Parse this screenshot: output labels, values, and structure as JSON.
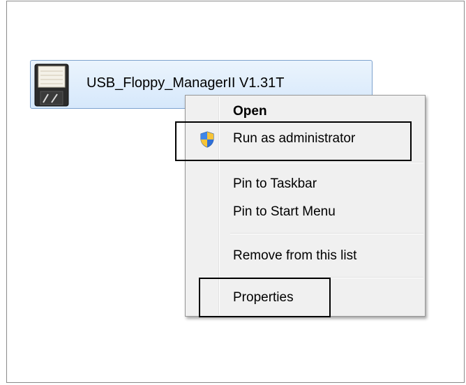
{
  "program": {
    "name": "USB_Floppy_ManagerII V1.31T",
    "icon": "floppy-disk-icon"
  },
  "context_menu": {
    "items": [
      {
        "label": "Open",
        "bold": true
      },
      {
        "label": "Run as administrator",
        "icon": "uac-shield-icon"
      },
      {
        "label": "Pin to Taskbar"
      },
      {
        "label": "Pin to Start Menu"
      },
      {
        "label": "Remove from this list"
      },
      {
        "label": "Properties"
      }
    ]
  },
  "colors": {
    "selection_border": "#7da2ce",
    "menu_background": "#f0f0f0",
    "highlight_box": "#000000"
  }
}
